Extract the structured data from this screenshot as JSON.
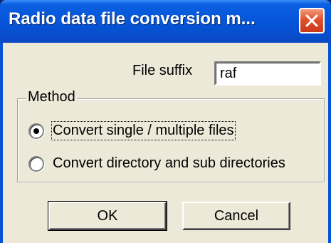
{
  "window": {
    "title": "Radio data file conversion m...",
    "close_icon": "close-icon"
  },
  "suffix": {
    "label": "File suffix",
    "value": "raf"
  },
  "method": {
    "group_label": "Method",
    "options": [
      {
        "label": "Convert single / multiple files",
        "selected": true
      },
      {
        "label": "Convert directory and sub directories",
        "selected": false
      }
    ]
  },
  "buttons": {
    "ok": "OK",
    "cancel": "Cancel"
  },
  "colors": {
    "titlebar": "#0553d6",
    "close_button": "#e0522d",
    "dialog_face": "#ece9d8"
  }
}
